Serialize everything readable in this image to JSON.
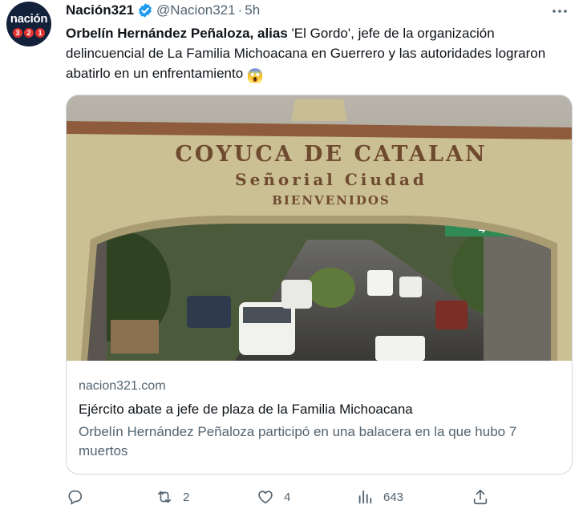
{
  "tweet": {
    "display_name": "Nación321",
    "handle": "@Nacion321",
    "separator": "·",
    "time": "5h",
    "text_bold": "Orbelín Hernández Peñaloza, alias",
    "text_rest": " 'El Gordo', jefe de la organización delincuencial de La Familia Michoacana en Guerrero y las autoridades lograron abatirlo en un enfrentamiento ",
    "emoji": "😱"
  },
  "avatar": {
    "word": "nación",
    "digits": [
      "3",
      "2",
      "1"
    ]
  },
  "card": {
    "sign_line1": "COYUCA DE CATALAN",
    "sign_line2": "Señorial Ciudad",
    "sign_line3": "BIENVENIDOS",
    "street_sign": "➜",
    "domain": "nacion321.com",
    "title": "Ejército abate a jefe de plaza de la Familia Michoacana",
    "description": "Orbelín Hernández Peñaloza participó en una balacera en la que hubo 7 muertos"
  },
  "actions": {
    "replies": "",
    "retweets": "2",
    "likes": "4",
    "views": "643"
  },
  "colors": {
    "verified": "#1d9bf0",
    "secondary_text": "#536471",
    "avatar_bg": "#14213a",
    "avatar_red": "#e0322f"
  }
}
